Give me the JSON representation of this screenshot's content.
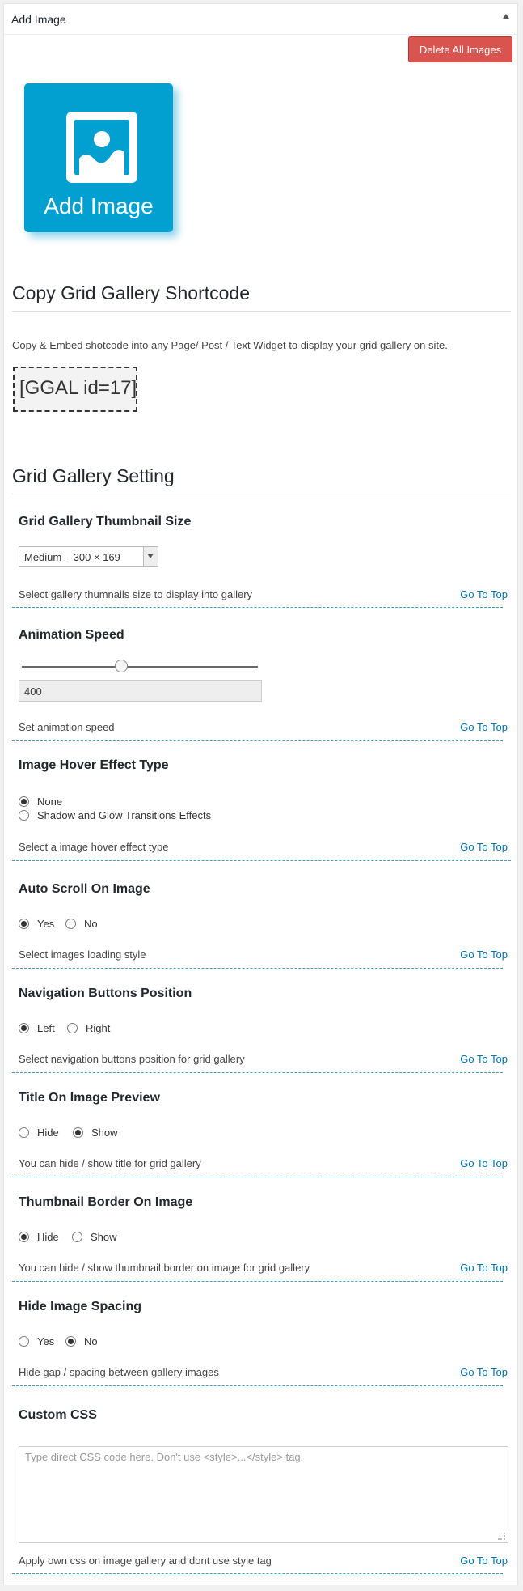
{
  "box": {
    "title": "Add Image"
  },
  "toolbar": {
    "delete_label": "Delete All Images"
  },
  "uploader": {
    "label": "Add Image"
  },
  "shortcode_section": {
    "heading": "Copy Grid Gallery Shortcode",
    "help": "Copy & Embed shotcode into any Page/ Post / Text Widget to display your grid gallery on site.",
    "shortcode": "[GGAL id=17]"
  },
  "settings": {
    "heading": "Grid Gallery Setting",
    "go_to_top": "Go To Top",
    "thumbnail_size": {
      "title": "Grid Gallery Thumbnail Size",
      "selected": "Medium – 300 × 169",
      "desc": "Select gallery thumnails size to display into gallery"
    },
    "animation_speed": {
      "title": "Animation Speed",
      "value": "400",
      "desc": "Set animation speed"
    },
    "hover_effect": {
      "title": "Image Hover Effect Type",
      "opt1": "None",
      "opt2": "Shadow and Glow Transitions Effects",
      "desc": "Select a image hover effect type"
    },
    "auto_scroll": {
      "title": "Auto Scroll On Image",
      "opt1": "Yes",
      "opt2": "No",
      "desc": "Select images loading style"
    },
    "nav_position": {
      "title": "Navigation Buttons Position",
      "opt1": "Left",
      "opt2": "Right",
      "desc": "Select navigation buttons position for grid gallery"
    },
    "title_preview": {
      "title": "Title On Image Preview",
      "opt1": "Hide",
      "opt2": "Show",
      "desc": "You can hide / show title for grid gallery"
    },
    "thumb_border": {
      "title": "Thumbnail Border On Image",
      "opt1": "Hide",
      "opt2": "Show",
      "desc": "You can hide / show thumbnail border on image for grid gallery"
    },
    "hide_spacing": {
      "title": "Hide Image Spacing",
      "opt1": "Yes",
      "opt2": "No",
      "desc": "Hide gap / spacing between gallery images"
    },
    "custom_css": {
      "title": "Custom CSS",
      "placeholder": "Type direct CSS code here. Don't use <style>...</style> tag.",
      "desc": "Apply own css on image gallery and dont use style tag"
    }
  }
}
